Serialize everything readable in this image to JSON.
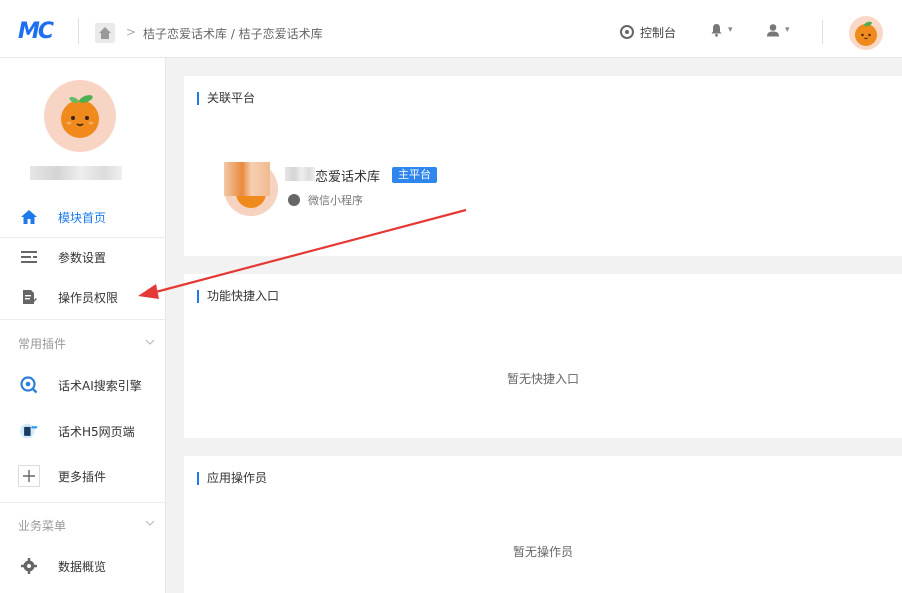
{
  "header": {
    "logo_text": "MC",
    "breadcrumb_sep": ">",
    "breadcrumb": "桔子恋爱话术库 / 桔子恋爱话术库",
    "console_label": "控制台",
    "caret": "▾"
  },
  "sidebar": {
    "nav_items": [
      {
        "label": "模块首页",
        "icon": "home-icon",
        "active": true
      },
      {
        "label": "参数设置",
        "icon": "settings-list-icon"
      },
      {
        "label": "操作员权限",
        "icon": "document-edit-icon"
      }
    ],
    "sections": [
      {
        "title": "常用插件",
        "items": [
          {
            "label": "话术AI搜索引擎",
            "icon": "ai-search-icon"
          },
          {
            "label": "话术H5网页端",
            "icon": "h5-page-icon"
          },
          {
            "label": "更多插件",
            "icon": "plus-icon"
          }
        ]
      },
      {
        "title": "业务菜单",
        "items": [
          {
            "label": "数据概览",
            "icon": "gear-icon"
          }
        ]
      }
    ]
  },
  "main": {
    "linked_platform": {
      "title": "关联平台",
      "platform_name": "恋爱话术库",
      "badge": "主平台",
      "platform_type": "微信小程序"
    },
    "quick_entry": {
      "title": "功能快捷入口",
      "empty_text": "暂无快捷入口"
    },
    "operators": {
      "title": "应用操作员",
      "empty_text": "暂无操作员"
    }
  },
  "colors": {
    "accent": "#1e7ae8",
    "badge": "#2f86ec",
    "annotation_arrow": "#e53935"
  }
}
